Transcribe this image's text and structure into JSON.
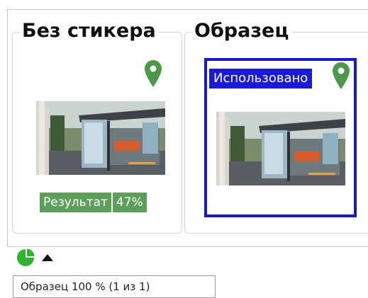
{
  "panels": {
    "without_sticker": {
      "title": "Без стикера",
      "result_label": "Результат",
      "result_value": "47%",
      "result_percent": 47
    },
    "sample": {
      "title": "Образец",
      "used_label": "Использовано"
    }
  },
  "icons": {
    "pin": "map-pin-icon",
    "status": "pie-chart-icon",
    "expand": "caret-up-icon"
  },
  "status": {
    "tooltip": "Образец 100 % (1 из 1)"
  },
  "colors": {
    "pin": "#4a9a4a",
    "result_bg": "#5b9f5b",
    "sample_border": "#1515e0",
    "used_badge_bg": "#1a1adf",
    "status_pie": "#2db52d"
  }
}
